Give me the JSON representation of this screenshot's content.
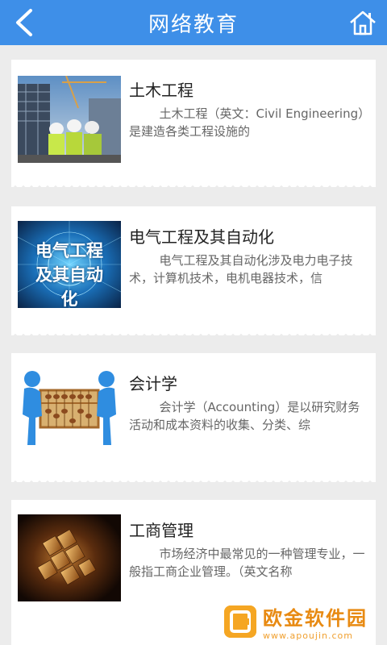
{
  "header": {
    "title": "网络教育"
  },
  "items": [
    {
      "title": "土木工程",
      "description": "土木工程（英文：Civil Engineering）是建造各类工程设施的",
      "image_icon": "construction-workers-image"
    },
    {
      "title": "电气工程及其自动化",
      "description": "电气工程及其自动化涉及电力电子技术，计算机技术，电机电器技术，信",
      "image_icon": "electrical-engineering-banner-image",
      "image_text": "电气工程及其自动化"
    },
    {
      "title": "会计学",
      "description": "会计学（Accounting）是以研究财务活动和成本资料的收集、分类、综",
      "image_icon": "abacus-figures-image"
    },
    {
      "title": "工商管理",
      "description": "市场经济中最常见的一种管理专业，一般指工商企业管理。（英文名称",
      "image_icon": "golden-gear-puzzle-image"
    }
  ],
  "watermark": {
    "name": "欧金软件园",
    "url": "www.apoujin.com"
  },
  "colors": {
    "header_bg": "#3e8fe8",
    "background": "#ececec"
  }
}
